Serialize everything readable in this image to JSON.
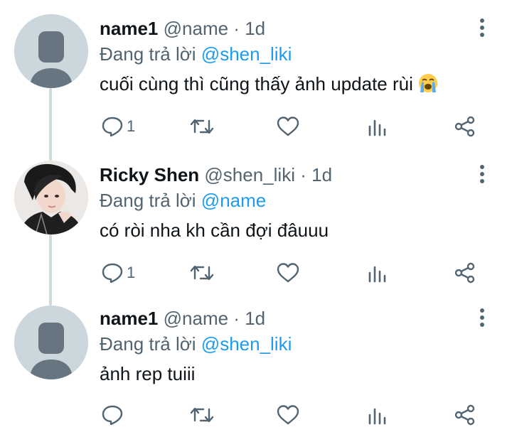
{
  "colors": {
    "accent": "#1d9bf0",
    "muted": "#536471",
    "text": "#0f1419",
    "thread": "#cfd9de"
  },
  "tweets": [
    {
      "name": "name1",
      "handle": "@name",
      "sep": "·",
      "time": "1d",
      "reply_label": "Đang trả lời",
      "reply_to": "@shen_liki",
      "text": "cuối cùng thì cũng thấy ảnh update rùi",
      "emoji": "loudly-crying-face-icon",
      "avatar": "default-avatar-icon",
      "reply_count": "1"
    },
    {
      "name": "Ricky Shen",
      "handle": "@shen_liki",
      "sep": "·",
      "time": "1d",
      "reply_label": "Đang trả lời",
      "reply_to": "@name",
      "text": "có ròi nha kh cần đợi đâuuu",
      "avatar": "profile-photo",
      "reply_count": "1"
    },
    {
      "name": "name1",
      "handle": "@name",
      "sep": "·",
      "time": "1d",
      "reply_label": "Đang trả lời",
      "reply_to": "@shen_liki",
      "text": "ảnh rep tuiii",
      "avatar": "default-avatar-icon",
      "reply_count": ""
    }
  ]
}
